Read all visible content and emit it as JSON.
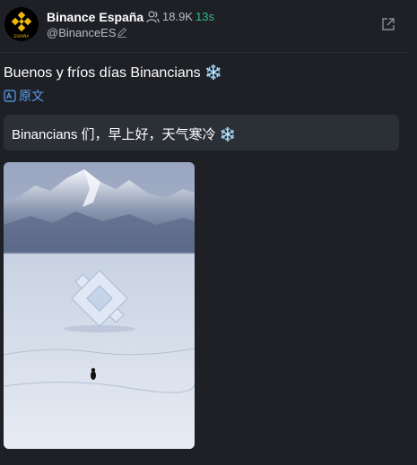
{
  "header": {
    "avatar_caption": "ESPAÑA",
    "name": "Binance España",
    "followers": "18.9K",
    "time_ago": "13s",
    "handle": "@BinanceES"
  },
  "post": {
    "text": "Buenos y fríos días Binancians",
    "emoji": "❄️",
    "translate_label": "原文",
    "translation": "Binancians 们，早上好，天气寒冷",
    "translation_emoji": "❄️"
  },
  "colors": {
    "background": "#1e2026",
    "panel": "#2b2f36",
    "accent": "#f0b90b",
    "link": "#5aa0f0",
    "green": "#2ebd85"
  },
  "icons": [
    "binance-logo-icon",
    "users-icon",
    "edit-icon",
    "external-link-icon",
    "translate-icon",
    "snowflake-icon"
  ]
}
